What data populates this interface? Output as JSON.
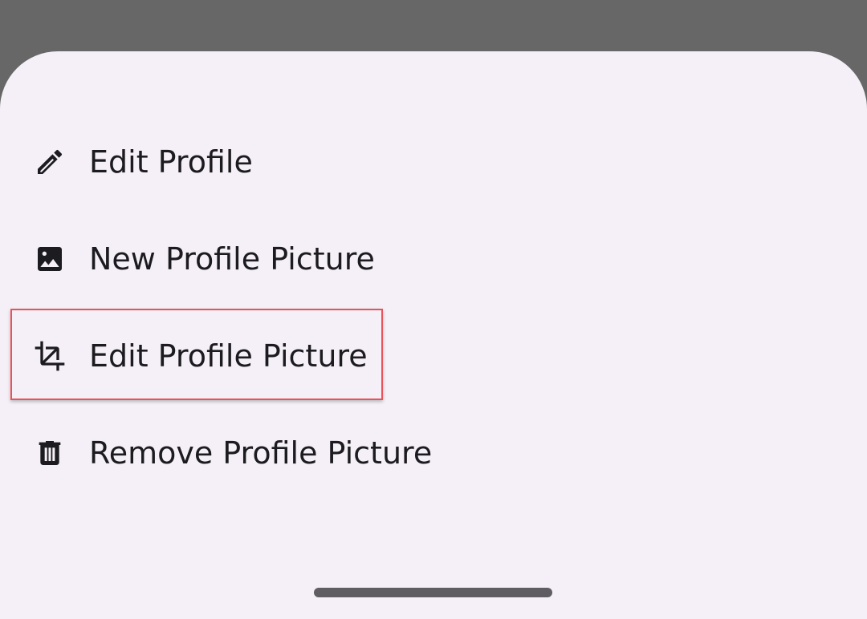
{
  "colors": {
    "scrim": "#676767",
    "sheet_background": "#f5f0f7",
    "text": "#1c1b1f",
    "highlight_border": "#e8535a",
    "home_indicator": "#5f5d62"
  },
  "bottom_sheet": {
    "items": [
      {
        "label": "Edit Profile",
        "icon": "pencil-icon"
      },
      {
        "label": "New Profile Picture",
        "icon": "image-icon"
      },
      {
        "label": "Edit Profile Picture",
        "icon": "crop-icon"
      },
      {
        "label": "Remove Profile Picture",
        "icon": "trash-icon"
      }
    ]
  }
}
